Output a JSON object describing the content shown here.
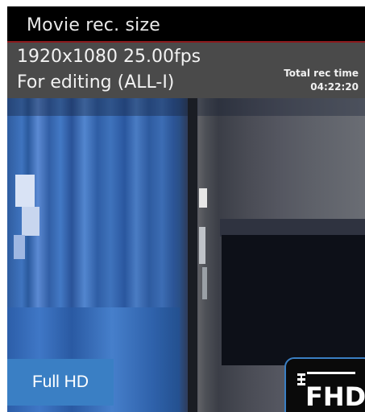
{
  "menu": {
    "title": "Movie rec. size",
    "setting_line1": "1920x1080 25.00fps",
    "setting_line2": "For editing (ALL-I)",
    "total_rec_time_label": "Total rec time",
    "total_rec_time_value": "04:22:20",
    "divider_color": "#8c1a1d"
  },
  "badge": {
    "label": "Full HD",
    "color": "#3a7fc4"
  },
  "icon": {
    "name": "fhd-icon",
    "text": "FHD"
  }
}
